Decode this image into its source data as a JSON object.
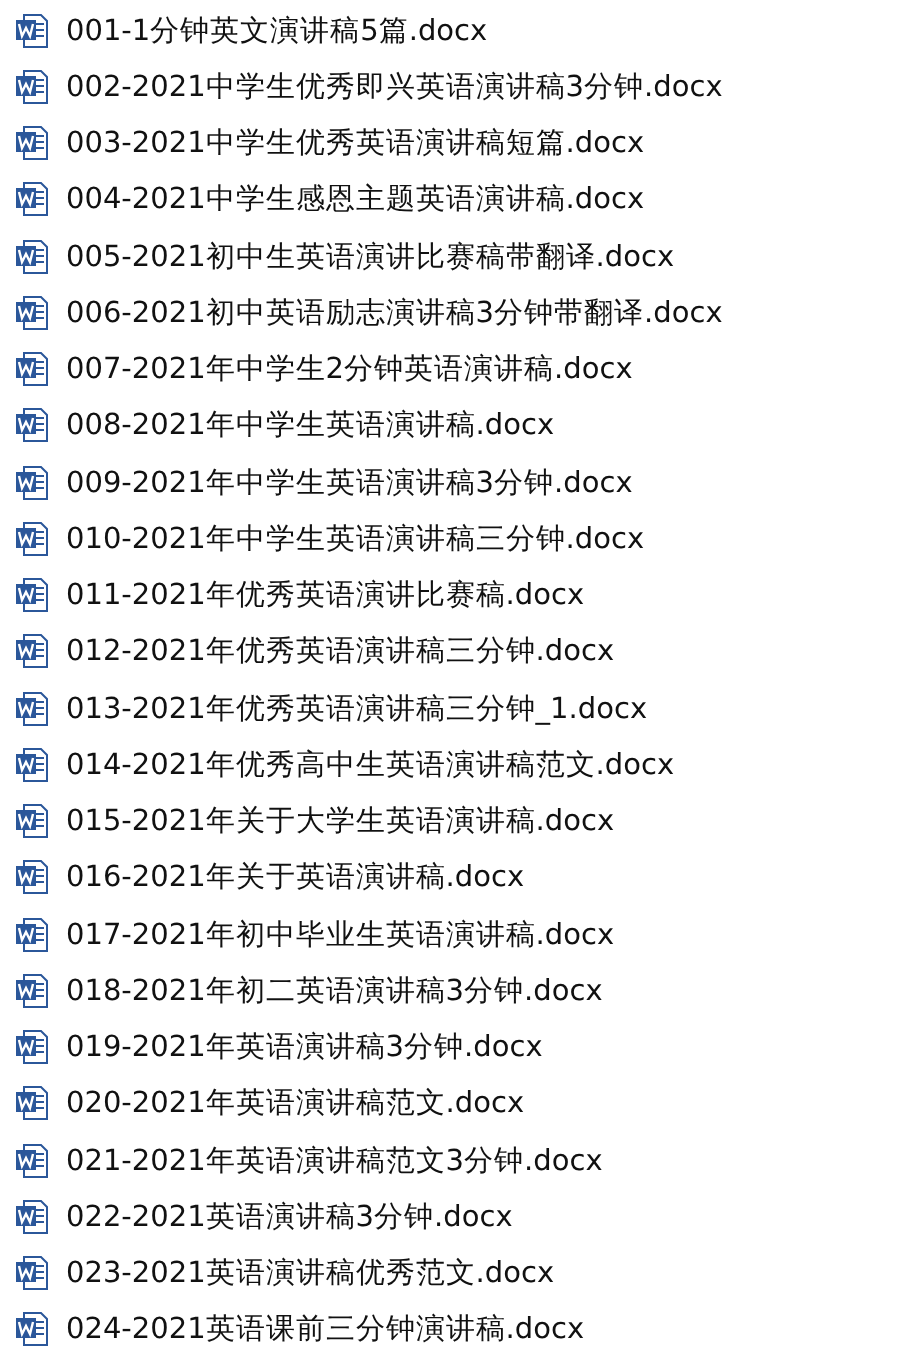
{
  "files": [
    {
      "name": "001-1分钟英文演讲稿5篇.docx"
    },
    {
      "name": "002-2021中学生优秀即兴英语演讲稿3分钟.docx"
    },
    {
      "name": "003-2021中学生优秀英语演讲稿短篇.docx"
    },
    {
      "name": "004-2021中学生感恩主题英语演讲稿.docx"
    },
    {
      "name": "005-2021初中生英语演讲比赛稿带翻译.docx"
    },
    {
      "name": "006-2021初中英语励志演讲稿3分钟带翻译.docx"
    },
    {
      "name": "007-2021年中学生2分钟英语演讲稿.docx"
    },
    {
      "name": "008-2021年中学生英语演讲稿.docx"
    },
    {
      "name": "009-2021年中学生英语演讲稿3分钟.docx"
    },
    {
      "name": "010-2021年中学生英语演讲稿三分钟.docx"
    },
    {
      "name": "011-2021年优秀英语演讲比赛稿.docx"
    },
    {
      "name": "012-2021年优秀英语演讲稿三分钟.docx"
    },
    {
      "name": "013-2021年优秀英语演讲稿三分钟_1.docx"
    },
    {
      "name": "014-2021年优秀高中生英语演讲稿范文.docx"
    },
    {
      "name": "015-2021年关于大学生英语演讲稿.docx"
    },
    {
      "name": "016-2021年关于英语演讲稿.docx"
    },
    {
      "name": "017-2021年初中毕业生英语演讲稿.docx"
    },
    {
      "name": "018-2021年初二英语演讲稿3分钟.docx"
    },
    {
      "name": "019-2021年英语演讲稿3分钟.docx"
    },
    {
      "name": "020-2021年英语演讲稿范文.docx"
    },
    {
      "name": "021-2021年英语演讲稿范文3分钟.docx"
    },
    {
      "name": "022-2021英语演讲稿3分钟.docx"
    },
    {
      "name": "023-2021英语演讲稿优秀范文.docx"
    },
    {
      "name": "024-2021英语课前三分钟演讲稿.docx"
    }
  ]
}
